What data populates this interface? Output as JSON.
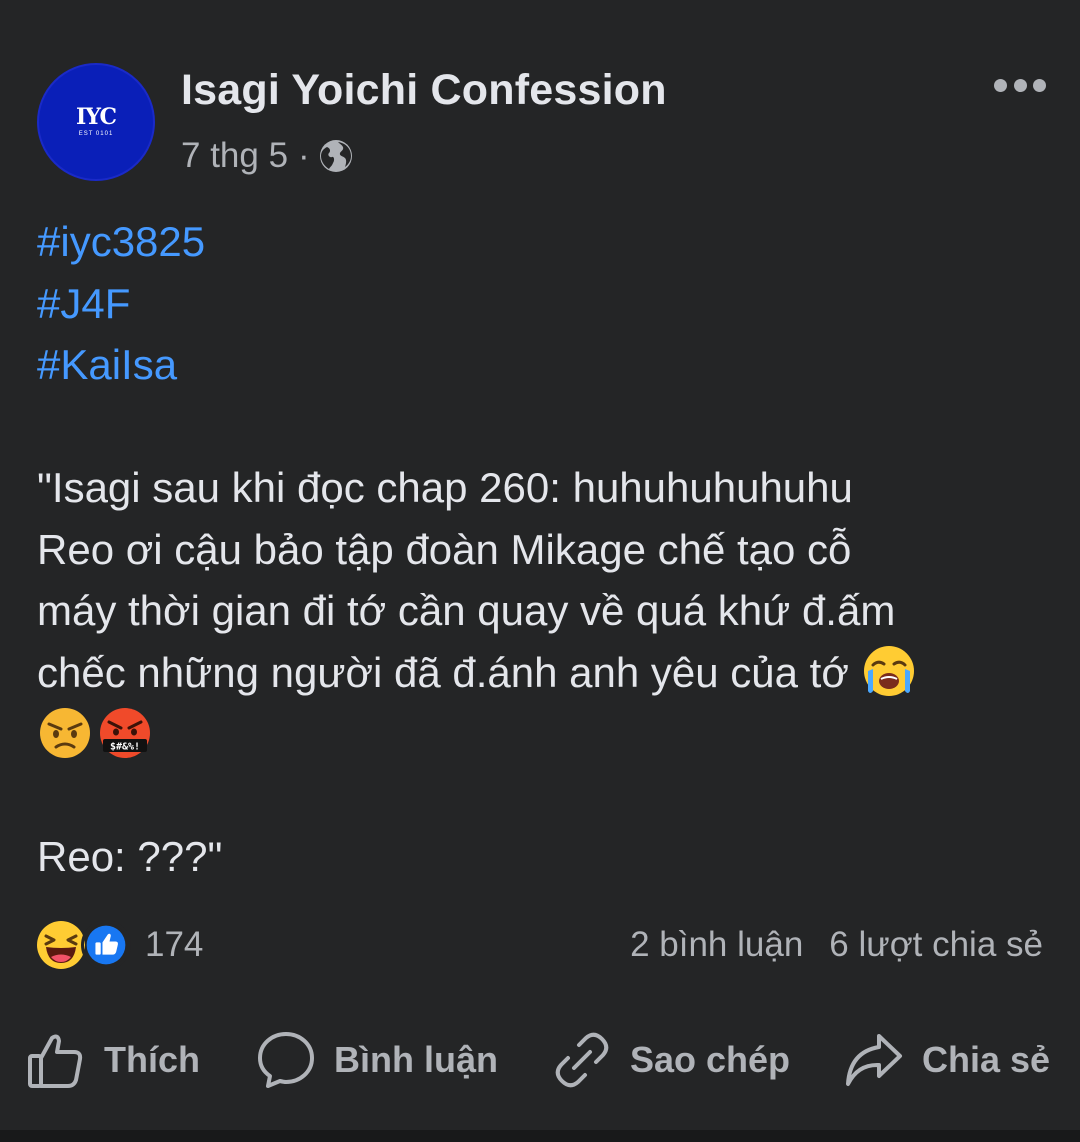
{
  "post": {
    "page_name": "Isagi Yoichi Confession",
    "avatar": {
      "monogram": "IYC",
      "est": "EST 0101",
      "color": "#0a1fb8"
    },
    "time": "7 thg 5",
    "separator": "·",
    "privacy_icon": "globe-icon",
    "more_icon": "more-options-icon",
    "hashtags": [
      "#iyc3825",
      "#J4F",
      "#KaiIsa"
    ],
    "body_lines": [
      "\"Isagi sau khi đọc chap 260: huhuhuhuhuhu",
      "Reo ơi cậu bảo tập đoàn Mikage chế tạo cỗ",
      "máy thời gian đi tớ cần quay về quá khứ đ.ấm",
      "chếc những người đã đ.ánh anh yêu của tớ"
    ],
    "emojis": [
      "loudly-crying-face",
      "angry-face",
      "face-with-symbols-on-mouth"
    ],
    "symbols_text": "$#&%!",
    "closing_line": "Reo: ???\""
  },
  "reactions": {
    "icons": [
      "haha-reaction-icon",
      "like-reaction-icon"
    ],
    "count": "174"
  },
  "stats": {
    "comments": "2 bình luận",
    "shares": "6 lượt chia sẻ"
  },
  "actions": {
    "like": "Thích",
    "comment": "Bình luận",
    "copy": "Sao chép",
    "share": "Chia sẻ"
  },
  "colors": {
    "background": "#242526",
    "text": "#e4e6eb",
    "secondary": "#b0b3b8",
    "hashtag": "#4599ff"
  }
}
